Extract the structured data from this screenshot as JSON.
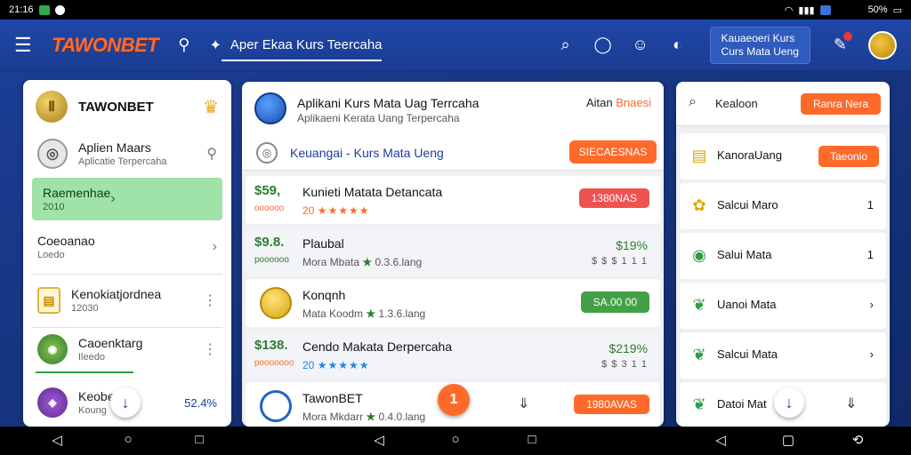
{
  "statusbar": {
    "time": "21:16",
    "battery": "50%"
  },
  "appbar": {
    "logo": "TAWONBET",
    "title": "Aper Ekaa Kurs Teercaha",
    "account_box": [
      "Kauaeoeri Kurs",
      "Curs Mata Ueng"
    ]
  },
  "left_panel": {
    "header_name": "TAWONBET",
    "items": [
      {
        "title": "Aplien Maars",
        "sub": "Aplicatie Terpercaha"
      },
      {
        "title": "Raemenhae",
        "sub": "2010"
      },
      {
        "title": "Coeoanao",
        "sub": "Loedo"
      },
      {
        "title": "Kenokiatjordnea",
        "sub": "12030"
      },
      {
        "title": "Caoenktarg",
        "sub": "Ileedo"
      },
      {
        "title": "Keobe",
        "sub": "Koung",
        "value": "52.4%"
      }
    ]
  },
  "mid_panel": {
    "header": {
      "title": "Aplikani Kurs Mata Uag Terrcaha",
      "subtitle": "Aplikaeni Kerata Uang Terpercaha",
      "right_text": "Aitan ",
      "right_highlight": "Bnaesi",
      "sub_label": "Keuangai - Kurs Mata Ueng",
      "sub_button": "SIECAESNAS"
    },
    "rows": [
      {
        "lead": "$59,",
        "lead_sub": "oooooo",
        "name": "Kunieti Matata Detancata",
        "rating": "20",
        "stars": "★★★★★",
        "pill": "1380NAS"
      },
      {
        "lead": "$9.8.",
        "lead_sub": "poooooo",
        "name": "Plaubal",
        "meta": "Mora Mbata",
        "meta2": "0.3.6.lang",
        "pct": "$19%",
        "pct_sub": "$ $ $ 1 1 1"
      },
      {
        "name": "Konqnh",
        "meta": "Mata Koodm",
        "meta2": "1.3.6.lang",
        "pill": "SA.00 00"
      },
      {
        "lead": "$138.",
        "lead_sub": "pooooooo",
        "name": "Cendo Makata Derpercaha",
        "rating": "20",
        "stars": "★★★★★",
        "pct": "$219%",
        "pct_sub": "$ $ 3 1 1"
      },
      {
        "name": "TawonBET",
        "meta": "Mora Mkdarr",
        "meta2": "0.4.0.lang",
        "pill": "1980AVAS",
        "fab": "1"
      }
    ]
  },
  "right_panel": {
    "search_label": "Kealoon",
    "search_button": "Ranra Nera",
    "rows": [
      {
        "label": "KanoraUang",
        "button": "Taeonio"
      },
      {
        "label": "Salcui Maro",
        "value": "1"
      },
      {
        "label": "Salui Mata",
        "value": "1"
      },
      {
        "label": "Uanoi Mata",
        "value": "›"
      },
      {
        "label": "Salcui Mata",
        "value": "›"
      },
      {
        "label": "Datoi Mat"
      }
    ]
  },
  "colors": {
    "primary": "#1a3d93",
    "accent": "#ff6a2b",
    "success": "#43a047",
    "danger": "#ef5350"
  }
}
